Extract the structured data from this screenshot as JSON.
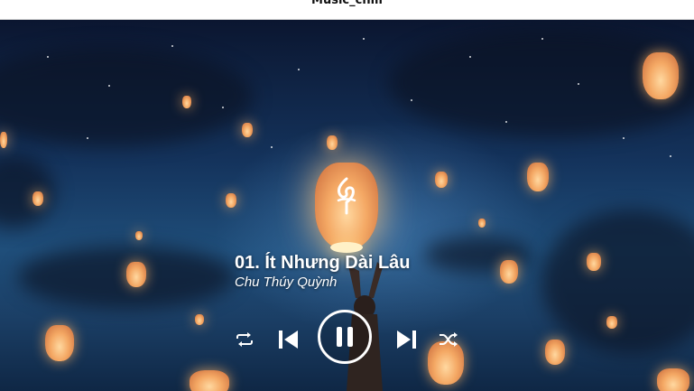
{
  "window": {
    "title": "Music_chill"
  },
  "player": {
    "track_title": "01. Ít Nhưng Dài Lâu",
    "artist": "Chu Thúy Quỳnh",
    "is_playing": true
  },
  "controls": {
    "repeat_icon": "repeat-icon",
    "previous_icon": "skip-previous-icon",
    "play_pause_icon": "pause-icon",
    "next_icon": "skip-next-icon",
    "shuffle_icon": "shuffle-icon"
  },
  "colors": {
    "text": "#ffffff",
    "lantern": "#f4a864",
    "sky_top": "#0b1630",
    "sky_mid": "#1f4e7a"
  }
}
